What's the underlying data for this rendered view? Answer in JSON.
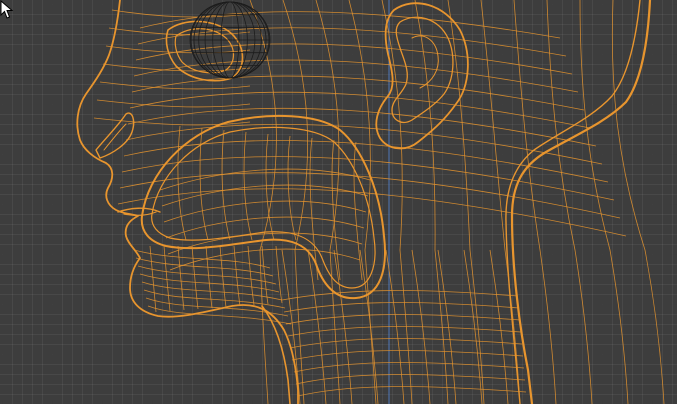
{
  "viewport": {
    "background_color": "#3d3d3d",
    "wire_color": "#e8952e",
    "eye_wire_color": "#1c1c1c",
    "axis_color": "#4f78b8"
  },
  "mesh": {
    "object": "head-wireframe"
  },
  "cursor": {
    "icon": "arrow-cursor-icon"
  }
}
